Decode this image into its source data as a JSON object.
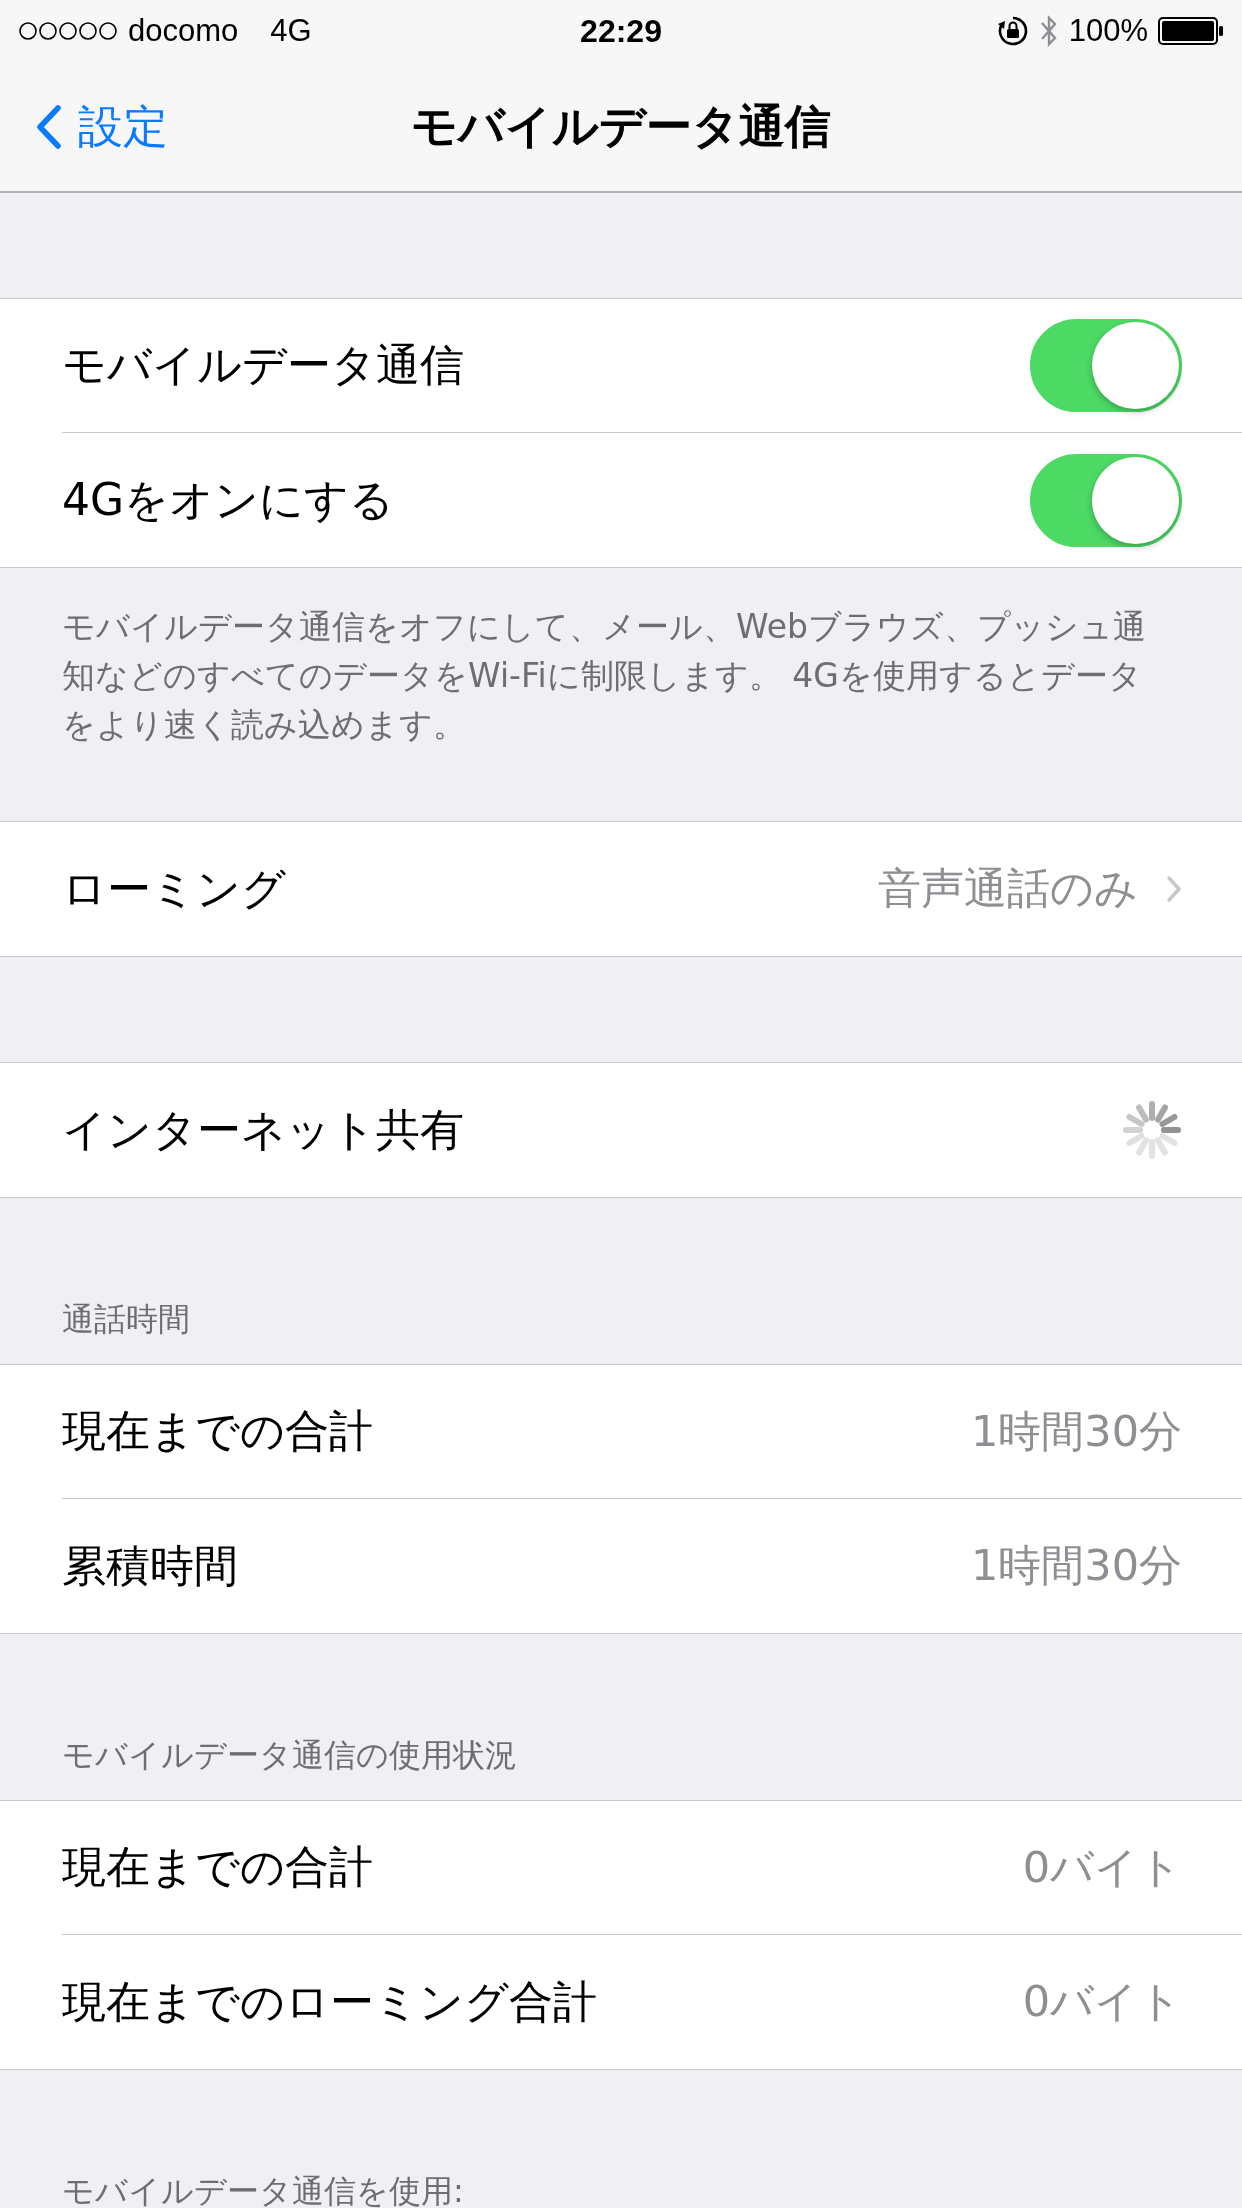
{
  "status_bar": {
    "carrier": "docomo",
    "network": "4G",
    "time": "22:29",
    "battery": "100%"
  },
  "nav": {
    "back": "設定",
    "title": "モバイルデータ通信"
  },
  "sections": [
    {
      "rows": [
        {
          "kind": "toggle",
          "label": "モバイルデータ通信",
          "on": true
        },
        {
          "kind": "toggle",
          "label": "4Gをオンにする",
          "on": true
        }
      ],
      "footer": "モバイルデータ通信をオフにして、メール、Webブラウズ、プッシュ通知などのすべてのデータをWi-Fiに制限します。 4Gを使用するとデータをより速く読み込めます。"
    },
    {
      "rows": [
        {
          "kind": "disclosure",
          "label": "ローミング",
          "value": "音声通話のみ"
        }
      ]
    },
    {
      "rows": [
        {
          "kind": "spinner",
          "label": "インターネット共有"
        }
      ]
    },
    {
      "header": "通話時間",
      "rows": [
        {
          "kind": "value",
          "label": "現在までの合計",
          "value": "1時間30分"
        },
        {
          "kind": "value",
          "label": "累積時間",
          "value": "1時間30分"
        }
      ]
    },
    {
      "header": "モバイルデータ通信の使用状況",
      "rows": [
        {
          "kind": "value",
          "label": "現在までの合計",
          "value": "0バイト"
        },
        {
          "kind": "value",
          "label": "現在までのローミング合計",
          "value": "0バイト"
        }
      ]
    },
    {
      "header": "モバイルデータ通信を使用:"
    }
  ]
}
